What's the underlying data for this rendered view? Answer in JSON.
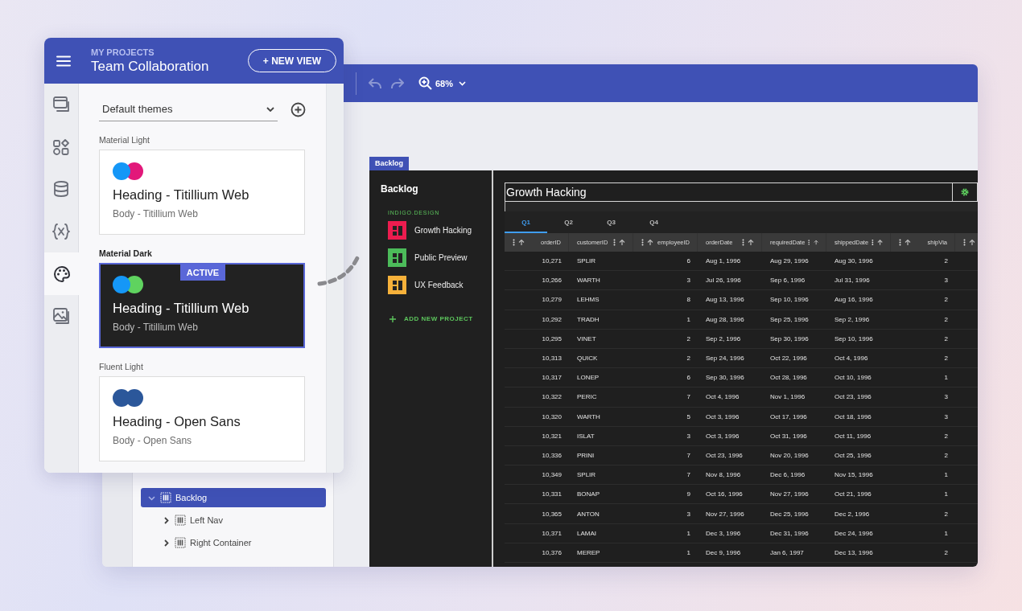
{
  "panel": {
    "section": "MY PROJECTS",
    "project": "Team Collaboration",
    "new_view_button": "+ NEW VIEW",
    "rail": [
      {
        "kind": "windows",
        "selected": false
      },
      {
        "kind": "components",
        "selected": false
      },
      {
        "kind": "database",
        "selected": false
      },
      {
        "kind": "variables",
        "selected": false
      },
      {
        "kind": "palette",
        "selected": true
      },
      {
        "kind": "images",
        "selected": false
      }
    ],
    "theme_select": {
      "value": "Default themes"
    },
    "themes": [
      {
        "label": "Material Light",
        "kind": "light",
        "selected": false,
        "swatches": [
          {
            "color": "#1597f7"
          },
          {
            "color": "#e2187a"
          }
        ],
        "heading": "Heading - Titillium Web",
        "body": "Body - Titillium Web"
      },
      {
        "label": "Material Dark",
        "kind": "dark",
        "selected": true,
        "badge": "ACTIVE",
        "swatches": [
          {
            "color": "#1597f7"
          },
          {
            "color": "#5fd35f"
          }
        ],
        "heading": "Heading - Titillium Web",
        "body": "Body - Titillium Web"
      },
      {
        "label": "Fluent Light",
        "kind": "light",
        "selected": false,
        "swatches": [
          {
            "color": "#2b579a"
          },
          {
            "color": "#2b579a"
          }
        ],
        "heading": "Heading - Open Sans",
        "body": "Body - Open Sans"
      }
    ]
  },
  "toolbar": {
    "undo": {
      "disabled": true
    },
    "redo": {
      "disabled": true
    },
    "zoom": "68%"
  },
  "tree": [
    {
      "label": "Backlog",
      "selected": true,
      "expanded": true,
      "children": [
        {
          "label": "Left Nav",
          "selected": false,
          "expanded": false
        },
        {
          "label": "Right Container",
          "selected": false,
          "expanded": false
        }
      ]
    }
  ],
  "frame": {
    "tab": "Backlog",
    "nav": {
      "title": "Backlog",
      "brand": "INDIGO.DESIGN",
      "projects": [
        {
          "name": "Growth Hacking",
          "color": "#ec1c4f"
        },
        {
          "name": "Public Preview",
          "color": "#4cbb5a"
        },
        {
          "name": "UX Feedback",
          "color": "#f6b13a"
        }
      ],
      "add_project": "ADD NEW PROJECT"
    },
    "content": {
      "title": "Growth Hacking",
      "tabs": [
        {
          "label": "Q1",
          "selected": true
        },
        {
          "label": "Q2",
          "selected": false
        },
        {
          "label": "Q3",
          "selected": false
        },
        {
          "label": "Q4",
          "selected": false
        }
      ],
      "table": {
        "columns": [
          {
            "label": "orderID",
            "kind": "number"
          },
          {
            "label": "customerID",
            "kind": "text"
          },
          {
            "label": "employeeID",
            "kind": "number"
          },
          {
            "label": "orderDate",
            "kind": "text"
          },
          {
            "label": "requiredDate",
            "kind": "text"
          },
          {
            "label": "shippedDate",
            "kind": "text"
          },
          {
            "label": "shipVia",
            "kind": "number"
          }
        ],
        "rows": [
          [
            "10,271",
            "SPLIR",
            "6",
            "Aug 1, 1996",
            "Aug 29, 1996",
            "Aug 30, 1996",
            "2"
          ],
          [
            "10,266",
            "WARTH",
            "3",
            "Jul 26, 1996",
            "Sep 6, 1996",
            "Jul 31, 1996",
            "3"
          ],
          [
            "10,279",
            "LEHMS",
            "8",
            "Aug 13, 1996",
            "Sep 10, 1996",
            "Aug 16, 1996",
            "2"
          ],
          [
            "10,292",
            "TRADH",
            "1",
            "Aug 28, 1996",
            "Sep 25, 1996",
            "Sep 2, 1996",
            "2"
          ],
          [
            "10,295",
            "VINET",
            "2",
            "Sep 2, 1996",
            "Sep 30, 1996",
            "Sep 10, 1996",
            "2"
          ],
          [
            "10,313",
            "QUICK",
            "2",
            "Sep 24, 1996",
            "Oct 22, 1996",
            "Oct 4, 1996",
            "2"
          ],
          [
            "10,317",
            "LONEP",
            "6",
            "Sep 30, 1996",
            "Oct 28, 1996",
            "Oct 10, 1996",
            "1"
          ],
          [
            "10,322",
            "PERIC",
            "7",
            "Oct 4, 1996",
            "Nov 1, 1996",
            "Oct 23, 1996",
            "3"
          ],
          [
            "10,320",
            "WARTH",
            "5",
            "Oct 3, 1996",
            "Oct 17, 1996",
            "Oct 18, 1996",
            "3"
          ],
          [
            "10,321",
            "ISLAT",
            "3",
            "Oct 3, 1996",
            "Oct 31, 1996",
            "Oct 11, 1996",
            "2"
          ],
          [
            "10,336",
            "PRINI",
            "7",
            "Oct 23, 1996",
            "Nov 20, 1996",
            "Oct 25, 1996",
            "2"
          ],
          [
            "10,349",
            "SPLIR",
            "7",
            "Nov 8, 1996",
            "Dec 6, 1996",
            "Nov 15, 1996",
            "1"
          ],
          [
            "10,331",
            "BONAP",
            "9",
            "Oct 16, 1996",
            "Nov 27, 1996",
            "Oct 21, 1996",
            "1"
          ],
          [
            "10,365",
            "ANTON",
            "3",
            "Nov 27, 1996",
            "Dec 25, 1996",
            "Dec 2, 1996",
            "2"
          ],
          [
            "10,371",
            "LAMAI",
            "1",
            "Dec 3, 1996",
            "Dec 31, 1996",
            "Dec 24, 1996",
            "1"
          ],
          [
            "10,376",
            "MEREP",
            "1",
            "Dec 9, 1996",
            "Jan 6, 1997",
            "Dec 13, 1996",
            "2"
          ]
        ]
      }
    }
  }
}
